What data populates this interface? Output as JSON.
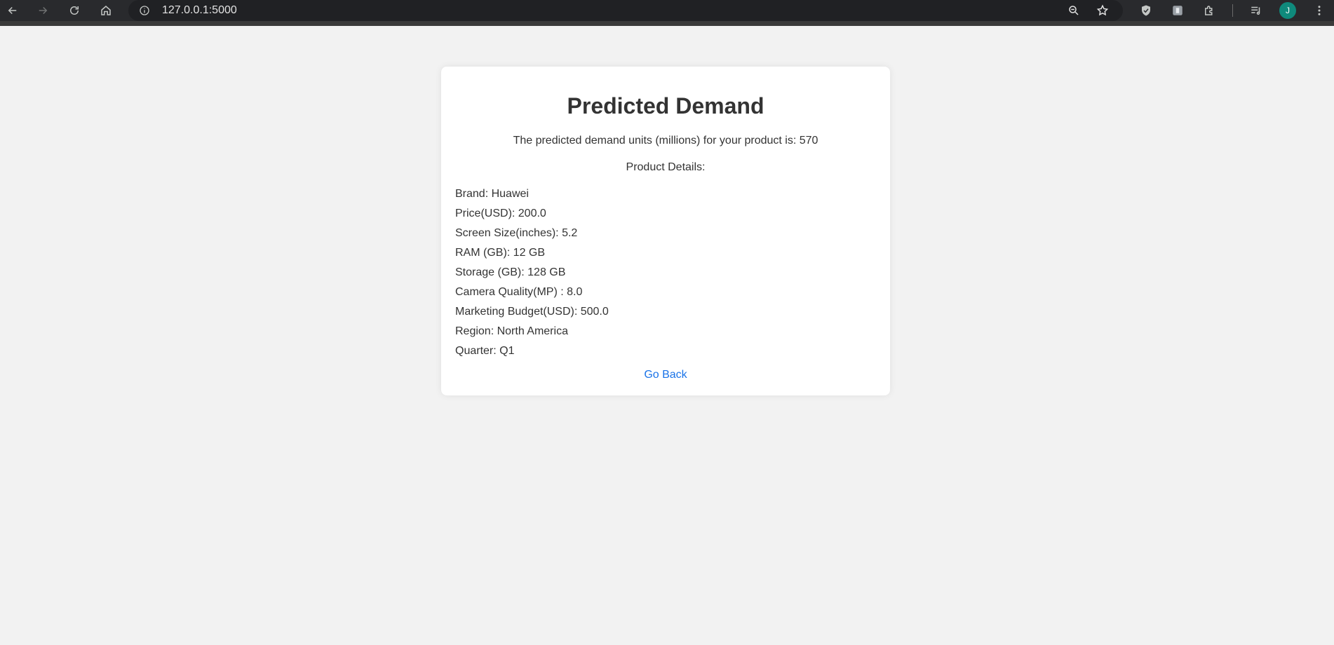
{
  "browser": {
    "url": "127.0.0.1:5000",
    "profile_initial": "J",
    "icons": {
      "back": "back-arrow-icon",
      "forward": "forward-arrow-icon",
      "reload": "reload-icon",
      "home": "home-icon",
      "site_info": "info-icon",
      "zoom": "zoom-out-icon",
      "bookmark": "star-icon",
      "extension_shield": "shield-icon",
      "extension_2": "extension-icon",
      "extensions": "puzzle-icon",
      "media": "media-queue-icon",
      "menu": "kebab-menu-icon"
    }
  },
  "card": {
    "title": "Predicted Demand",
    "prediction_text": "The predicted demand units (millions) for your product is: 570",
    "details_heading": "Product Details:",
    "details": [
      "Brand: Huawei",
      "Price(USD): 200.0",
      "Screen Size(inches): 5.2",
      "RAM (GB): 12 GB",
      "Storage (GB): 128 GB",
      "Camera Quality(MP) : 8.0",
      "Marketing Budget(USD): 500.0",
      "Region: North America",
      "Quarter: Q1"
    ],
    "go_back_label": "Go Back"
  },
  "colors": {
    "page_bg": "#f2f2f2",
    "card_bg": "#ffffff",
    "text": "#333333",
    "link": "#1a73e8",
    "avatar": "#0f8a7c"
  }
}
